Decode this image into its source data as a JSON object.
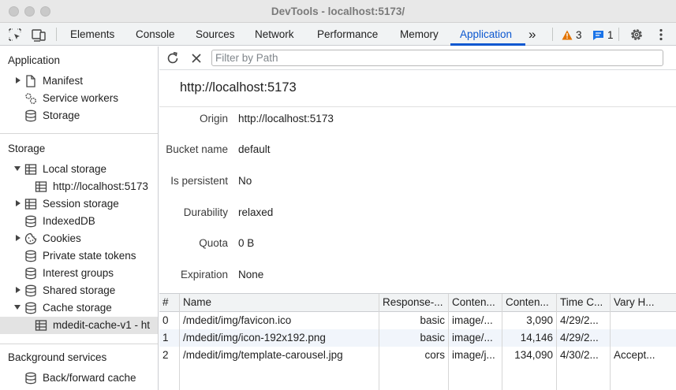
{
  "window": {
    "title": "DevTools - localhost:5173/"
  },
  "toolbar": {
    "tabs": [
      {
        "label": "Elements"
      },
      {
        "label": "Console"
      },
      {
        "label": "Sources"
      },
      {
        "label": "Network"
      },
      {
        "label": "Performance"
      },
      {
        "label": "Memory"
      },
      {
        "label": "Application"
      }
    ],
    "active_tab": "Application",
    "more_tabs": "»",
    "warnings_count": "3",
    "messages_count": "1",
    "colors": {
      "accent": "#0b57d0",
      "warning": "#e37400"
    }
  },
  "sidebar": {
    "application_title": "Application",
    "application_items": [
      {
        "label": "Manifest",
        "icon": "document-icon",
        "expandable": true
      },
      {
        "label": "Service workers",
        "icon": "gears-icon",
        "expandable": false
      },
      {
        "label": "Storage",
        "icon": "database-icon",
        "expandable": false
      }
    ],
    "storage_title": "Storage",
    "storage_items": [
      {
        "label": "Local storage",
        "icon": "table-icon",
        "expanded": true
      },
      {
        "label": "http://localhost:5173",
        "icon": "table-icon",
        "child": true
      },
      {
        "label": "Session storage",
        "icon": "table-icon",
        "expandable": true
      },
      {
        "label": "IndexedDB",
        "icon": "database-icon"
      },
      {
        "label": "Cookies",
        "icon": "cookie-icon",
        "expandable": true
      },
      {
        "label": "Private state tokens",
        "icon": "database-icon"
      },
      {
        "label": "Interest groups",
        "icon": "database-icon"
      },
      {
        "label": "Shared storage",
        "icon": "database-icon",
        "expandable": true
      },
      {
        "label": "Cache storage",
        "icon": "database-icon",
        "expanded": true
      },
      {
        "label": "mdedit-cache-v1 - ht",
        "icon": "table-icon",
        "child": true,
        "selected": true
      }
    ],
    "background_title": "Background services",
    "background_items": [
      {
        "label": "Back/forward cache",
        "icon": "database-icon"
      }
    ]
  },
  "filter": {
    "placeholder": "Filter by Path",
    "value": ""
  },
  "bucket": {
    "origin_heading": "http://localhost:5173",
    "fields": [
      {
        "label": "Origin",
        "value": "http://localhost:5173"
      },
      {
        "label": "Bucket name",
        "value": "default"
      },
      {
        "label": "Is persistent",
        "value": "No"
      },
      {
        "label": "Durability",
        "value": "relaxed"
      },
      {
        "label": "Quota",
        "value": "0 B"
      },
      {
        "label": "Expiration",
        "value": "None"
      }
    ]
  },
  "cache_table": {
    "columns": [
      "#",
      "Name",
      "Response-...",
      "Conten...",
      "Conten...",
      "Time C...",
      "Vary H..."
    ],
    "rows": [
      [
        "0",
        "/mdedit/img/favicon.ico",
        "basic",
        "image/...",
        "3,090",
        "4/29/2...",
        ""
      ],
      [
        "1",
        "/mdedit/img/icon-192x192.png",
        "basic",
        "image/...",
        "14,146",
        "4/29/2...",
        ""
      ],
      [
        "2",
        "/mdedit/img/template-carousel.jpg",
        "cors",
        "image/j...",
        "134,090",
        "4/30/2...",
        "Accept..."
      ]
    ]
  }
}
